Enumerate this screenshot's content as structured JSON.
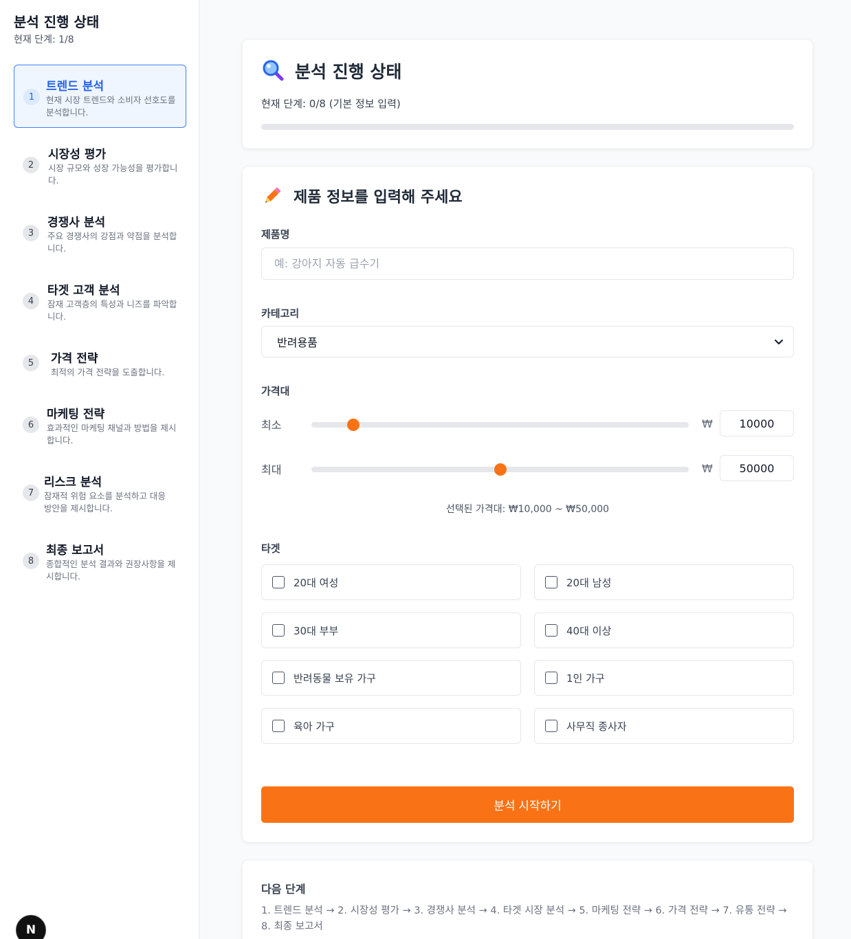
{
  "sidebar": {
    "title": "분석 진행 상태",
    "current_step": "현재 단계: 1/8",
    "steps": [
      {
        "num": "1",
        "title": "트렌드 분석",
        "desc": "현재 시장 트렌드와 소비자 선호도를 분석합니다.",
        "active": true
      },
      {
        "num": "2",
        "title": "시장성 평가",
        "desc": "시장 규모와 성장 가능성을 평가합니다."
      },
      {
        "num": "3",
        "title": "경쟁사 분석",
        "desc": "주요 경쟁사의 강점과 약점을 분석합니다."
      },
      {
        "num": "4",
        "title": "타겟 고객 분석",
        "desc": "잠재 고객층의 특성과 니즈를 파악합니다."
      },
      {
        "num": "5",
        "title": "가격 전략",
        "desc": "최적의 가격 전략을 도출합니다."
      },
      {
        "num": "6",
        "title": "마케팅 전략",
        "desc": "효과적인 마케팅 채널과 방법을 제시합니다."
      },
      {
        "num": "7",
        "title": "리스크 분석",
        "desc": "잠재적 위험 요소를 분석하고 대응 방안을 제시합니다."
      },
      {
        "num": "8",
        "title": "최종 보고서",
        "desc": "종합적인 분석 결과와 권장사항을 제시합니다."
      }
    ],
    "badge": "N"
  },
  "status_card": {
    "icon": "magnifier-icon",
    "title": "분석 진행 상태",
    "progress_text": "현재 단계: 0/8 (기본 정보 입력)",
    "progress_fraction": 0
  },
  "form": {
    "icon": "pencil-icon",
    "title": "제품 정보를 입력해 주세요",
    "product_label": "제품명",
    "product_value": "",
    "product_placeholder": "예: 강아지 자동 급수기",
    "category_label": "카테고리",
    "category_value": "반려용품",
    "price_label": "가격대",
    "min_label": "최소",
    "max_label": "최대",
    "currency": "₩",
    "min_value": "10000",
    "max_value": "50000",
    "min_fraction": 0.112,
    "max_fraction": 0.5,
    "price_summary": "선택된 가격대: ₩10,000 ~ ₩50,000",
    "target_label": "타겟",
    "targets": [
      "20대 여성",
      "20대 남성",
      "30대 부부",
      "40대 이상",
      "반려동물 보유 가구",
      "1인 가구",
      "육아 가구",
      "사무직 종사자"
    ],
    "submit": "분석 시작하기"
  },
  "next": {
    "title": "다음 단계",
    "flow": "1. 트렌드 분석 → 2. 시장성 평가 → 3. 경쟁사 분석 → 4. 타겟 시장 분석 → 5. 마케팅 전략 → 6. 가격 전략 → 7. 유통 전략 → 8. 최종 보고서"
  },
  "colors": {
    "accent": "#f97316",
    "active_step": "#2563eb"
  }
}
